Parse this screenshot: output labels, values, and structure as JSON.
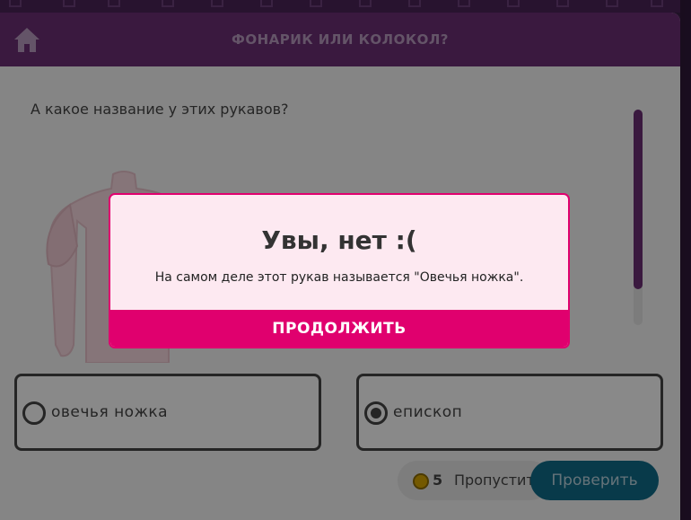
{
  "header": {
    "title": "ФОНАРИК ИЛИ КОЛОКОЛ?",
    "home_icon": "home-icon"
  },
  "question": {
    "text": "А какое название у этих рукавов?"
  },
  "options": [
    {
      "label": "овечья ножка",
      "selected": false
    },
    {
      "label": "епископ",
      "selected": true
    }
  ],
  "footer": {
    "coins": "5",
    "skip_label": "Пропустить",
    "check_label": "Проверить"
  },
  "dialog": {
    "title": "Увы, нет :(",
    "message": "На самом деле этот рукав называется \"Овечья ножка\".",
    "continue_label": "ПРОДОЛЖИТЬ"
  },
  "colors": {
    "header": "#6a2f73",
    "accent": "#e0006e",
    "dialog_bg": "#fde9f1",
    "check_button": "#106a88"
  }
}
